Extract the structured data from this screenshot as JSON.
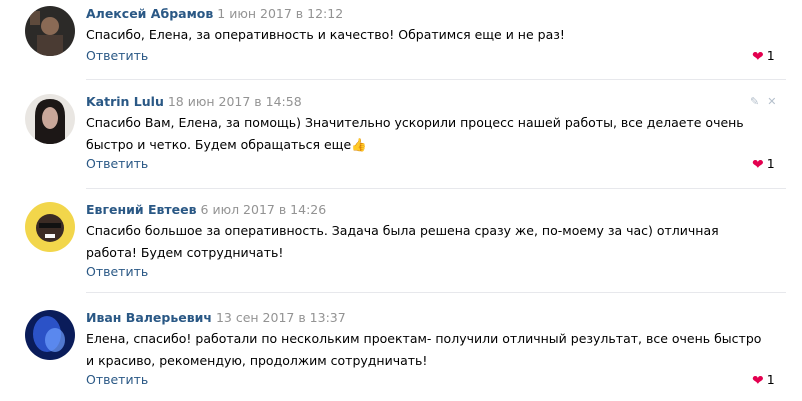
{
  "comments": [
    {
      "author": "Алексей Абрамов",
      "date": "1 июн 2017 в 12:12",
      "text": "Спасибо, Елена, за оперативность и качество! Обратимся еще и не раз!",
      "reply_label": "Ответить",
      "likes": "1",
      "avatar_icon": "user-photo-avatar"
    },
    {
      "author": "Katrin Lulu",
      "date": "18 июн 2017 в 14:58",
      "text": "Спасибо Вам, Елена, за помощь) Значительно ускорили процесс нашей работы, все делаете очень быстро и четко. Будем обращаться еще👍",
      "reply_label": "Ответить",
      "likes": "1",
      "avatar_icon": "user-photo-avatar"
    },
    {
      "author": "Евгений Евтеев",
      "date": "6 июл 2017 в 14:26",
      "text": "Спасибо большое за оперативность. Задача была решена сразу же, по-моему за час) отличная работа! Будем сотрудничать!",
      "reply_label": "Ответить",
      "avatar_icon": "user-photo-avatar"
    },
    {
      "author": "Иван Валерьевич",
      "date": "13 сен 2017 в 13:37",
      "text": "Елена, спасибо! работали по нескольким проектам- получили отличный результат, все очень быстро и красиво, рекомендую, продолжим сотрудничать!",
      "reply_label": "Ответить",
      "likes": "1",
      "avatar_icon": "user-photo-avatar"
    }
  ],
  "icons": {
    "like": "heart-icon",
    "edit": "pencil-icon",
    "delete": "close-icon"
  },
  "colors": {
    "author": "#2a5885",
    "date": "#939393",
    "heart": "#e3004f",
    "divider": "#e7e8ec"
  }
}
